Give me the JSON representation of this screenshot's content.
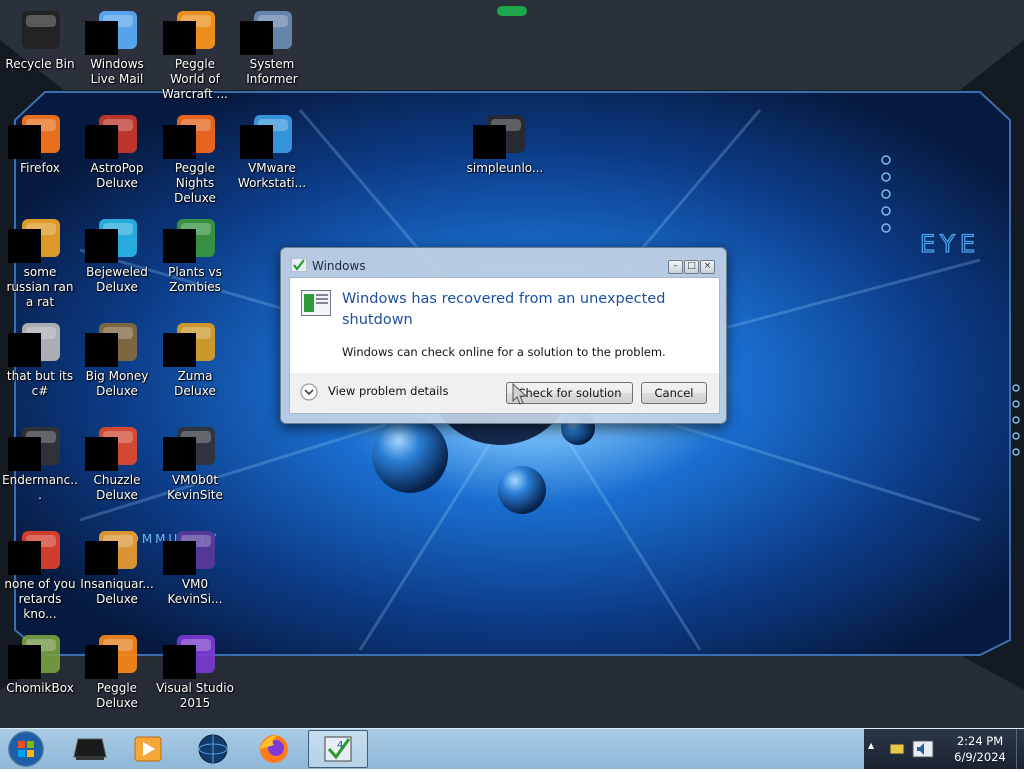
{
  "desktop": {
    "icons": [
      {
        "label": "Recycle Bin",
        "icon": "recycle-bin-icon"
      },
      {
        "label": "Windows Live Mail",
        "icon": "windows-live-mail-icon"
      },
      {
        "label": "Peggle World of Warcraft ...",
        "icon": "peggle-wow-icon"
      },
      {
        "label": "System Informer",
        "icon": "system-informer-icon"
      },
      {
        "label": "Firefox",
        "icon": "firefox-icon"
      },
      {
        "label": "AstroPop Deluxe",
        "icon": "astropop-icon"
      },
      {
        "label": "Peggle Nights Deluxe",
        "icon": "peggle-nights-icon"
      },
      {
        "label": "VMware Workstati...",
        "icon": "vmware-icon"
      },
      {
        "label": "some russian ran a rat",
        "icon": "app-icon"
      },
      {
        "label": "Bejeweled Deluxe",
        "icon": "bejeweled-icon"
      },
      {
        "label": "Plants vs Zombies",
        "icon": "pvz-icon"
      },
      {
        "label": "that but its c#",
        "icon": "app-icon"
      },
      {
        "label": "Big Money Deluxe",
        "icon": "big-money-icon"
      },
      {
        "label": "Zuma Deluxe",
        "icon": "zuma-icon"
      },
      {
        "label": "Endermanc...",
        "icon": "app-icon"
      },
      {
        "label": "Chuzzle Deluxe",
        "icon": "chuzzle-icon"
      },
      {
        "label": "VM0b0t KevinSite",
        "icon": "folder-icon"
      },
      {
        "label": "none of you retards kno...",
        "icon": "app-icon"
      },
      {
        "label": "Insaniquar... Deluxe",
        "icon": "insaniquarium-icon"
      },
      {
        "label": "VM0 KevinSi...",
        "icon": "app-icon"
      },
      {
        "label": "ChomikBox",
        "icon": "chomikbox-icon"
      },
      {
        "label": "Peggle Deluxe",
        "icon": "peggle-icon"
      },
      {
        "label": "Visual Studio 2015",
        "icon": "visual-studio-icon"
      },
      {
        "label": "simpleunlo...",
        "icon": "folder-icon"
      }
    ]
  },
  "wallpaper": {
    "text_eye": "EYE",
    "text_community": "COMMUNITY"
  },
  "dialog": {
    "title": "Windows",
    "heading": "Windows has recovered from an unexpected shutdown",
    "description": "Windows can check online for a solution to the problem.",
    "details_label": "View problem details",
    "check_button": "Check for solution",
    "cancel_button": "Cancel"
  },
  "taskbar": {
    "time": "2:24 PM",
    "date": "6/9/2024"
  },
  "colors": {
    "taskbar": "#9bc1de",
    "dialog_heading": "#1e4f9e",
    "wallpaper_blue": "#1a6fd0"
  }
}
